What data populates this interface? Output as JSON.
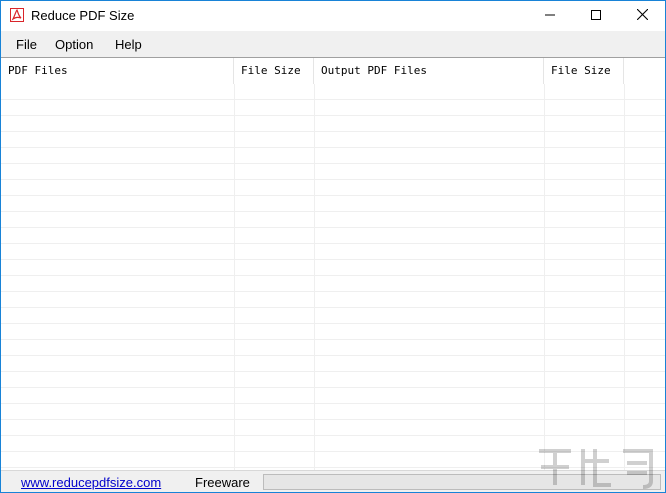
{
  "window": {
    "title": "Reduce PDF Size"
  },
  "menu": {
    "file": "File",
    "option": "Option",
    "help": "Help"
  },
  "list": {
    "columns": [
      "PDF Files",
      "File Size",
      "Output PDF Files",
      "File Size"
    ],
    "rows": []
  },
  "status": {
    "link": "www.reducepdfsize.com",
    "license": "Freeware",
    "progress": 0
  },
  "colors": {
    "accent": "#1883d7",
    "link": "#0000cc",
    "icon_red": "#d9252a"
  },
  "icons": [
    "pdf-app-icon",
    "minimize-icon",
    "maximize-icon",
    "close-icon"
  ]
}
